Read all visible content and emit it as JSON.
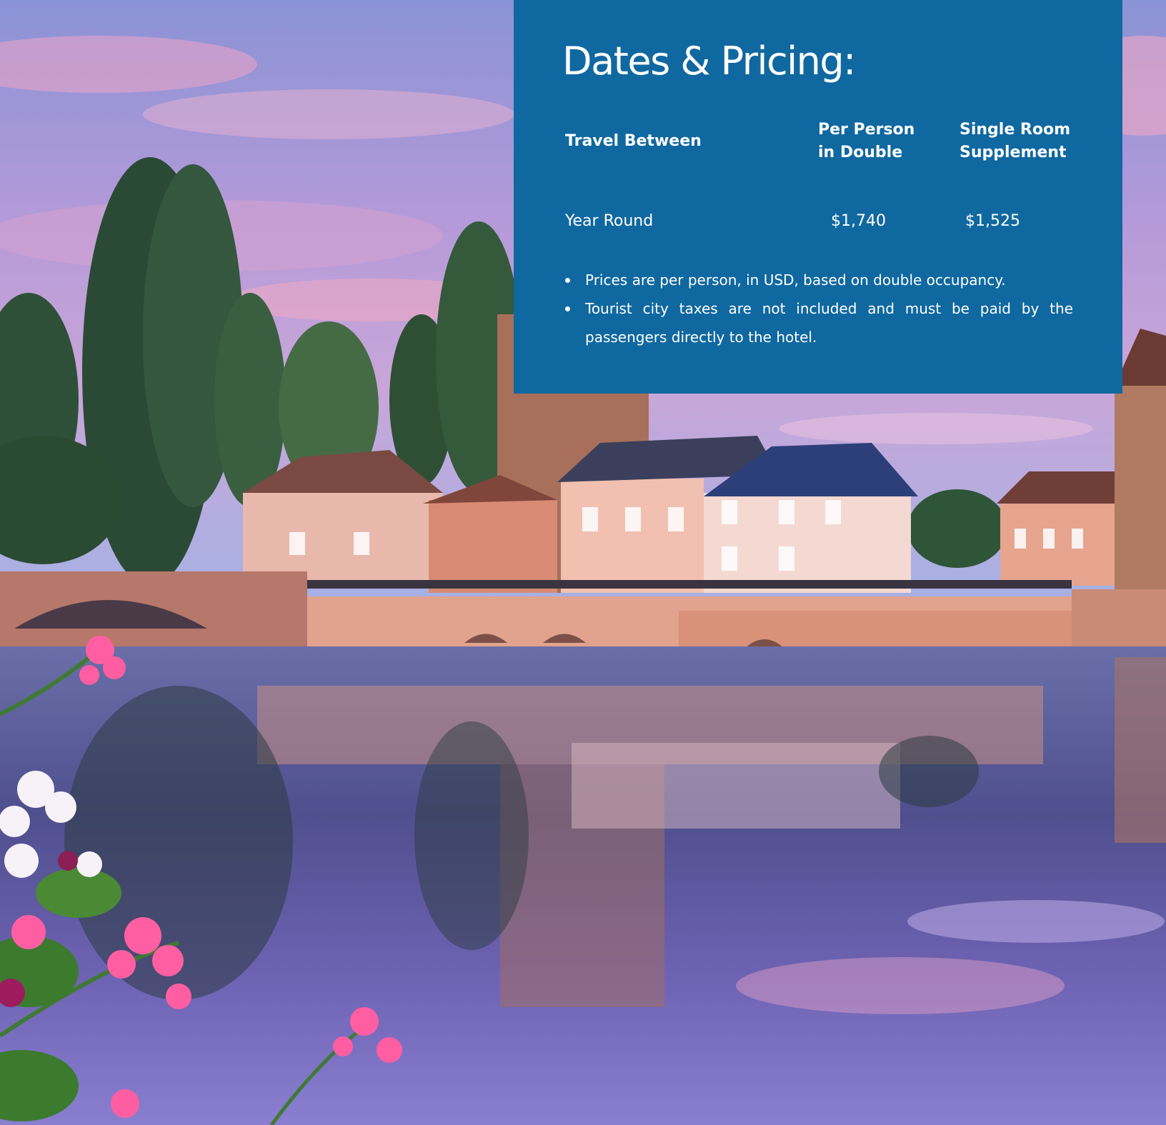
{
  "pricing": {
    "title": "Dates & Pricing:",
    "columns": [
      "Travel Between",
      "Per Person\nin Double",
      "Single Room\nSupplement"
    ],
    "rows": [
      {
        "period": "Year Round",
        "per_person_double": "$1,740",
        "single_supplement": "$1,525"
      }
    ],
    "notes": [
      "Prices are per person, in USD, based on double occupancy.",
      "Tourist city taxes are not included and must be paid by the passengers directly to the hotel."
    ]
  },
  "colors": {
    "panel_background": "#1068a0",
    "panel_text": "#ffffff"
  }
}
